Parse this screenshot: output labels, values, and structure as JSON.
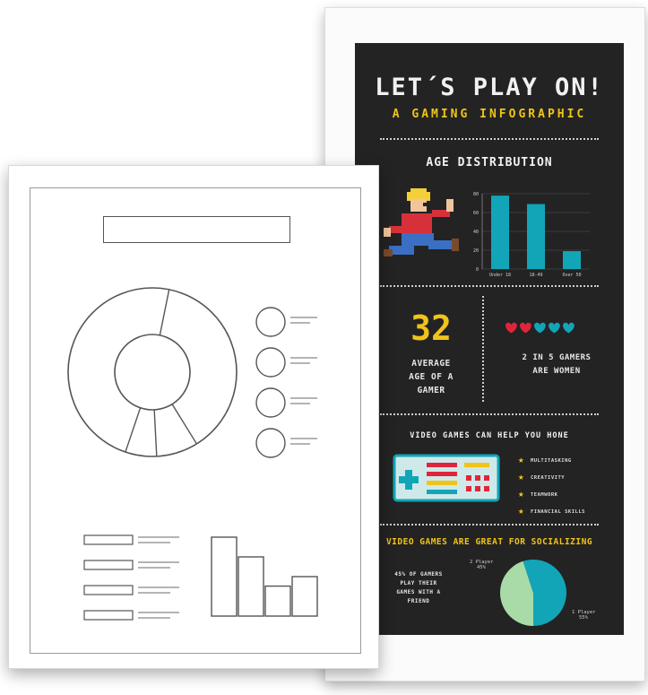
{
  "poster": {
    "title": "LET´S PLAY ON!",
    "subtitle": "A GAMING INFOGRAPHIC",
    "colors": {
      "background": "#232323",
      "accent_yellow": "#f0c419",
      "teal": "#12a5b8",
      "red": "#e0253a",
      "green": "#a8dba8"
    },
    "age_section": {
      "title": "AGE DISTRIBUTION",
      "icon": "running-pixel-boy-icon"
    },
    "stats": {
      "average_age": "32",
      "average_age_label": [
        "AVERAGE",
        "AGE OF A",
        "GAMER"
      ],
      "women_label": [
        "2 IN 5 GAMERS",
        "ARE WOMEN"
      ],
      "hearts_icon": "hearts-row-icon"
    },
    "hone": {
      "title": "VIDEO GAMES CAN HELP YOU HONE",
      "controller_icon": "game-controller-icon",
      "skills": [
        "MULTITASKING",
        "CREATIVITY",
        "TEAMWORK",
        "FINANCIAL SKILLS"
      ]
    },
    "social": {
      "title": "VIDEO GAMES ARE GREAT FOR SOCIALIZING",
      "text": [
        "45% OF GAMERS",
        "PLAY THEIR",
        "GAMES WITH A",
        "FRIEND"
      ],
      "label_a": [
        "2 Player",
        "45%"
      ],
      "label_b": [
        "1 Player",
        "55%"
      ]
    }
  },
  "chart_data": [
    {
      "type": "bar",
      "title": "AGE DISTRIBUTION",
      "categories": [
        "Under 18",
        "18-49",
        "Over 50"
      ],
      "values": [
        78,
        69,
        19
      ],
      "yticks": [
        "80",
        "60",
        "40",
        "20",
        "0"
      ],
      "ylim": [
        0,
        80
      ],
      "color": "#12a5b8"
    },
    {
      "type": "pie",
      "labels": [
        "2 Player",
        "1 Player"
      ],
      "values": [
        45,
        55
      ],
      "colors": [
        "#a8dba8",
        "#12a5b8"
      ]
    }
  ],
  "wireframe": {
    "donut_segments": [
      38,
      8,
      6,
      48
    ],
    "legend_items": 4,
    "row_items": 4,
    "bars": [
      1.0,
      0.75,
      0.38,
      0.5
    ]
  }
}
